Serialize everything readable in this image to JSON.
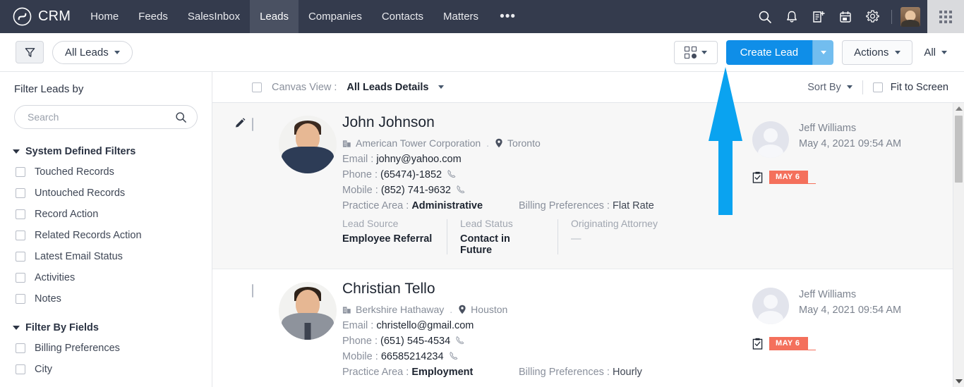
{
  "topnav": {
    "brand": "CRM",
    "items": [
      {
        "label": "Home",
        "active": false
      },
      {
        "label": "Feeds",
        "active": false
      },
      {
        "label": "SalesInbox",
        "active": false
      },
      {
        "label": "Leads",
        "active": true
      },
      {
        "label": "Companies",
        "active": false
      },
      {
        "label": "Contacts",
        "active": false
      },
      {
        "label": "Matters",
        "active": false
      }
    ],
    "more": "•••",
    "icons": [
      "search-icon",
      "bell-icon",
      "add-note-icon",
      "calendar-icon",
      "gear-icon"
    ]
  },
  "toolbar": {
    "filter_icon": "funnel-icon",
    "view_selector": "All Leads",
    "view_toggle_icon": "canvas-view-icon",
    "create_lead": "Create Lead",
    "actions": "Actions",
    "all": "All"
  },
  "sidebar": {
    "title": "Filter Leads by",
    "search_placeholder": "Search",
    "search_value": "",
    "groups": [
      {
        "label": "System Defined Filters",
        "items": [
          {
            "label": "Touched Records"
          },
          {
            "label": "Untouched Records"
          },
          {
            "label": "Record Action"
          },
          {
            "label": "Related Records Action"
          },
          {
            "label": "Latest Email Status"
          },
          {
            "label": "Activities"
          },
          {
            "label": "Notes"
          }
        ]
      },
      {
        "label": "Filter By Fields",
        "items": [
          {
            "label": "Billing Preferences"
          },
          {
            "label": "City"
          }
        ]
      }
    ]
  },
  "list_header": {
    "canvas_label": "Canvas View :",
    "canvas_value": "All Leads Details",
    "sort_by": "Sort By",
    "fit_to_screen": "Fit to Screen"
  },
  "labels": {
    "email": "Email :",
    "phone": "Phone :",
    "mobile": "Mobile :",
    "practice_area": "Practice Area :",
    "billing_preferences": "Billing Preferences :",
    "lead_source": "Lead Source",
    "lead_status": "Lead Status",
    "originating_attorney": "Originating Attorney",
    "dot": "."
  },
  "records": [
    {
      "name": "John Johnson",
      "company": "American Tower Corporation",
      "city": "Toronto",
      "email": "johny@yahoo.com",
      "phone": "(65474)-1852",
      "mobile": "(852) 741-9632",
      "practice_area": "Administrative",
      "billing_preferences": "Flat Rate",
      "lead_source": "Employee Referral",
      "lead_status": "Contact in Future",
      "originating_attorney": "—",
      "owner": "Jeff Williams",
      "modified": "May 4, 2021 09:54 AM",
      "task_badge": "MAY 6"
    },
    {
      "name": "Christian Tello",
      "company": "Berkshire Hathaway",
      "city": "Houston",
      "email": "christello@gmail.com",
      "phone": "(651) 545-4534",
      "mobile": "66585214234",
      "practice_area": "Employment",
      "billing_preferences": "Hourly",
      "owner": "Jeff Williams",
      "modified": "May 4, 2021 09:54 AM",
      "task_badge": "MAY 6"
    }
  ],
  "colors": {
    "nav_bg": "#343b4d",
    "primary": "#0f8ee8",
    "badge": "#f4705c",
    "annotation_arrow": "#0aa3f0"
  }
}
